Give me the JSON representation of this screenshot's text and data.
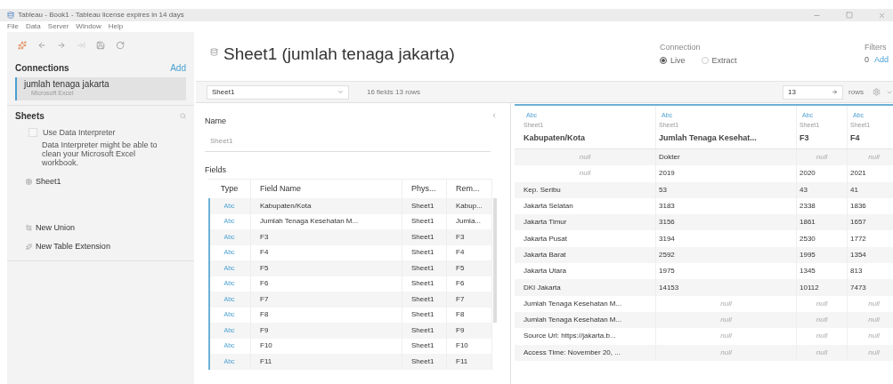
{
  "window": {
    "title": "Tableau - Book1 - Tableau license expires in 14 days"
  },
  "menu": [
    "File",
    "Data",
    "Server",
    "Window",
    "Help"
  ],
  "sidebar": {
    "connections_label": "Connections",
    "add": "Add",
    "connection": {
      "name": "jumlah tenaga jakarta",
      "type": "Microsoft Excel"
    },
    "sheets_label": "Sheets",
    "interpreter": {
      "label": "Use Data Interpreter",
      "checked": false,
      "hint": "Data Interpreter might be able to clean your Microsoft Excel workbook."
    },
    "sheets": [
      "Sheet1"
    ],
    "actions": [
      {
        "kind": "union",
        "label": "New Union"
      },
      {
        "kind": "extension",
        "label": "New Table Extension"
      }
    ]
  },
  "header": {
    "title": "Sheet1 (jumlah tenaga jakarta)",
    "connection_label": "Connection",
    "connection_options": [
      {
        "label": "Live",
        "selected": true
      },
      {
        "label": "Extract",
        "selected": false
      }
    ],
    "filters_label": "Filters",
    "filters_count": "0",
    "filters_add": "Add"
  },
  "toolbar": {
    "table": "Sheet1",
    "summary": "16 fields 13 rows",
    "rows_value": "13",
    "rows_label": "rows"
  },
  "details": {
    "name_label": "Name",
    "name_value": "Sheet1",
    "fields_label": "Fields",
    "columns": [
      "Type",
      "Field Name",
      "Phys...",
      "Rem..."
    ],
    "rows": [
      [
        "Abc",
        "Kabupaten/Kota",
        "Sheet1",
        "Kabup..."
      ],
      [
        "Abc",
        "Jumlah Tenaga Kesehatan M...",
        "Sheet1",
        "Jumla..."
      ],
      [
        "Abc",
        "F3",
        "Sheet1",
        "F3"
      ],
      [
        "Abc",
        "F4",
        "Sheet1",
        "F4"
      ],
      [
        "Abc",
        "F5",
        "Sheet1",
        "F5"
      ],
      [
        "Abc",
        "F6",
        "Sheet1",
        "F6"
      ],
      [
        "Abc",
        "F7",
        "Sheet1",
        "F7"
      ],
      [
        "Abc",
        "F8",
        "Sheet1",
        "F8"
      ],
      [
        "Abc",
        "F9",
        "Sheet1",
        "F9"
      ],
      [
        "Abc",
        "F10",
        "Sheet1",
        "F10"
      ],
      [
        "Abc",
        "F11",
        "Sheet1",
        "F11"
      ]
    ]
  },
  "grid": {
    "columns": [
      {
        "type": "Abc",
        "source": "Sheet1",
        "name": "Kabupaten/Kota"
      },
      {
        "type": "Abc",
        "source": "Sheet1",
        "name": "Jumlah Tenaga Kesehat..."
      },
      {
        "type": "Abc",
        "source": "Sheet1",
        "name": "F3"
      },
      {
        "type": "Abc",
        "source": "Sheet1",
        "name": "F4"
      }
    ],
    "rows": [
      [
        {
          "text": "null",
          "kind": "null"
        },
        {
          "text": "Dokter",
          "kind": "value"
        },
        {
          "text": "null",
          "kind": "null"
        },
        {
          "text": "null",
          "kind": "null"
        }
      ],
      [
        {
          "text": "null",
          "kind": "null"
        },
        {
          "text": "2019",
          "kind": "value"
        },
        {
          "text": "2020",
          "kind": "value"
        },
        {
          "text": "2021",
          "kind": "value"
        }
      ],
      [
        {
          "text": "Kep. Seribu",
          "kind": "value"
        },
        {
          "text": "53",
          "kind": "value"
        },
        {
          "text": "43",
          "kind": "value"
        },
        {
          "text": "41",
          "kind": "value"
        }
      ],
      [
        {
          "text": "Jakarta Selatan",
          "kind": "value"
        },
        {
          "text": "3183",
          "kind": "value"
        },
        {
          "text": "2338",
          "kind": "value"
        },
        {
          "text": "1836",
          "kind": "value"
        }
      ],
      [
        {
          "text": "Jakarta Timur",
          "kind": "value"
        },
        {
          "text": "3156",
          "kind": "value"
        },
        {
          "text": "1861",
          "kind": "value"
        },
        {
          "text": "1657",
          "kind": "value"
        }
      ],
      [
        {
          "text": "Jakarta Pusat",
          "kind": "value"
        },
        {
          "text": "3194",
          "kind": "value"
        },
        {
          "text": "2530",
          "kind": "value"
        },
        {
          "text": "1772",
          "kind": "value"
        }
      ],
      [
        {
          "text": "Jakarta Barat",
          "kind": "value"
        },
        {
          "text": "2592",
          "kind": "value"
        },
        {
          "text": "1995",
          "kind": "value"
        },
        {
          "text": "1354",
          "kind": "value"
        }
      ],
      [
        {
          "text": "Jakarta Utara",
          "kind": "value"
        },
        {
          "text": "1975",
          "kind": "value"
        },
        {
          "text": "1345",
          "kind": "value"
        },
        {
          "text": "813",
          "kind": "value"
        }
      ],
      [
        {
          "text": "DKI Jakarta",
          "kind": "value"
        },
        {
          "text": "14153",
          "kind": "value"
        },
        {
          "text": "10112",
          "kind": "value"
        },
        {
          "text": "7473",
          "kind": "value"
        }
      ],
      [
        {
          "text": "Jumlah Tenaga Kesehatan M...",
          "kind": "value"
        },
        {
          "text": "null",
          "kind": "null"
        },
        {
          "text": "null",
          "kind": "null"
        },
        {
          "text": "null",
          "kind": "null"
        }
      ],
      [
        {
          "text": "Jumlah Tenaga Kesehatan M...",
          "kind": "value"
        },
        {
          "text": "null",
          "kind": "null"
        },
        {
          "text": "null",
          "kind": "null"
        },
        {
          "text": "null",
          "kind": "null"
        }
      ],
      [
        {
          "text": "Source Url: https://jakarta.b...",
          "kind": "value"
        },
        {
          "text": "null",
          "kind": "null"
        },
        {
          "text": "null",
          "kind": "null"
        },
        {
          "text": "null",
          "kind": "null"
        }
      ],
      [
        {
          "text": "Access Time: November 20, ...",
          "kind": "value"
        },
        {
          "text": "null",
          "kind": "null"
        },
        {
          "text": "null",
          "kind": "null"
        },
        {
          "text": "null",
          "kind": "null"
        }
      ]
    ]
  }
}
